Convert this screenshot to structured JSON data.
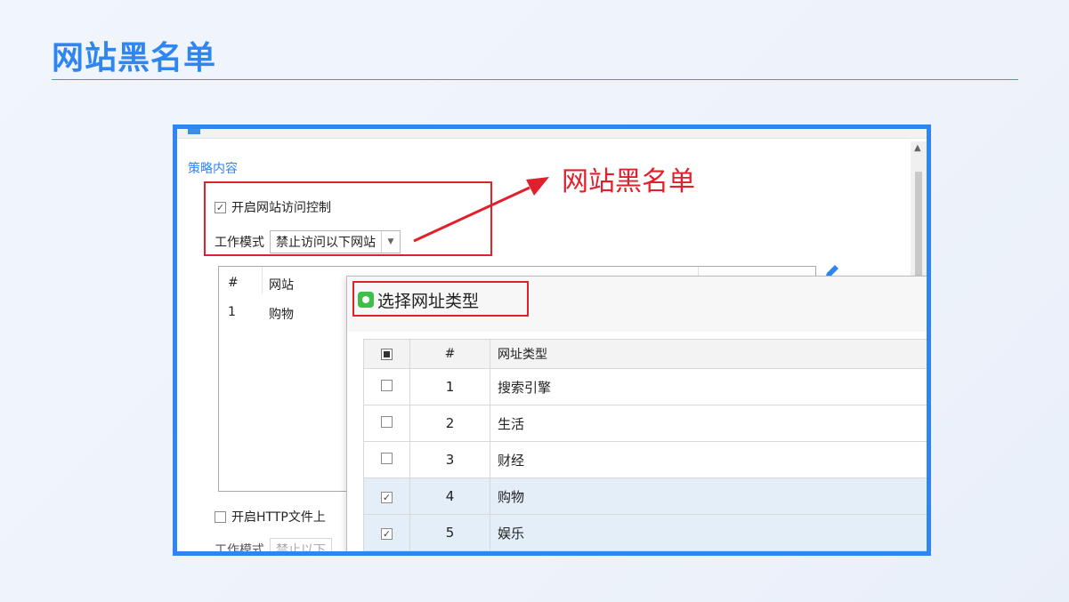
{
  "slide": {
    "title": "网站黑名单"
  },
  "policy": {
    "section_title": "策略内容",
    "enable_label": "开启网站访问控制",
    "enable_checked": true,
    "mode_label": "工作模式",
    "mode_value": "禁止访问以下网站",
    "annotation": "网站黑名单",
    "list": {
      "headers": [
        "#",
        "网站"
      ],
      "rows": [
        {
          "num": "1",
          "site": "购物"
        }
      ]
    },
    "http_label": "开启HTTP文件上",
    "http_checked": false,
    "mode2_label": "工作模式",
    "mode2_value": "禁止以下"
  },
  "dialog": {
    "title": "选择网址类型",
    "headers": [
      "#",
      "网址类型"
    ],
    "rows": [
      {
        "num": "1",
        "type": "搜索引擎",
        "checked": false
      },
      {
        "num": "2",
        "type": "生活",
        "checked": false
      },
      {
        "num": "3",
        "type": "财经",
        "checked": false
      },
      {
        "num": "4",
        "type": "购物",
        "checked": true
      },
      {
        "num": "5",
        "type": "娱乐",
        "checked": true
      }
    ]
  },
  "colors": {
    "accent": "#2f86f0",
    "annotation": "#e0202a",
    "selected_row": "#e4eef8"
  },
  "icons": [
    "checkbox-icon",
    "dropdown-arrow-icon",
    "pencil-icon",
    "app-icon",
    "scroll-up-icon"
  ]
}
